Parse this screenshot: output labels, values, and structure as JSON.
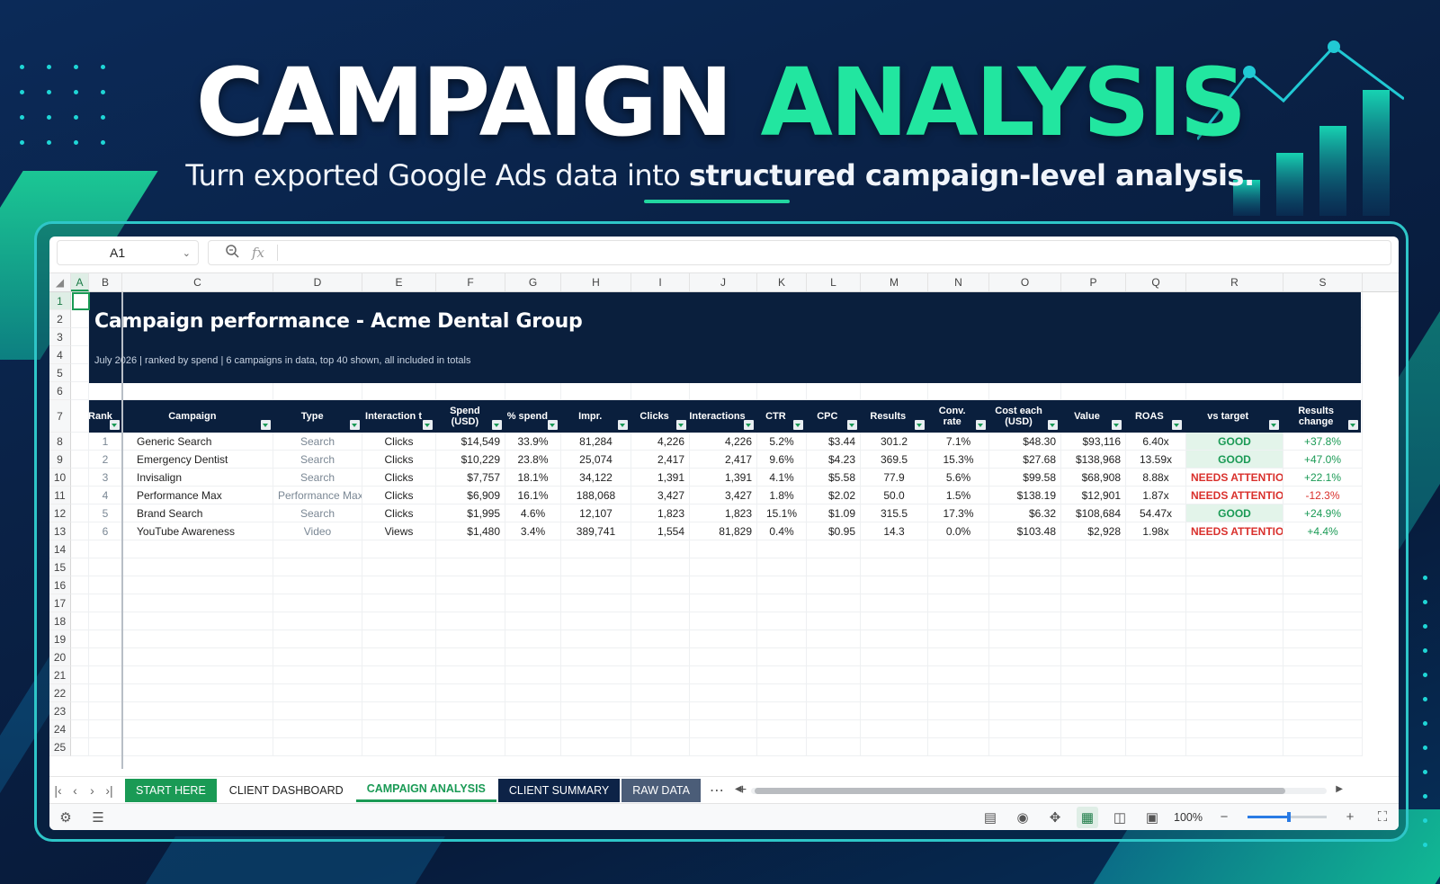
{
  "hero": {
    "title_word1": "CAMPAIGN",
    "title_word2": "ANALYSIS",
    "subtitle_plain": "Turn exported Google Ads data into ",
    "subtitle_bold": "structured campaign-level analysis."
  },
  "app": {
    "name_box": "A1",
    "formula": "",
    "columns": [
      "A",
      "B",
      "C",
      "D",
      "E",
      "F",
      "G",
      "H",
      "I",
      "J",
      "K",
      "L",
      "M",
      "N",
      "O",
      "P",
      "Q",
      "R",
      "S"
    ],
    "row_numbers": [
      "1",
      "2",
      "3",
      "4",
      "5",
      "6",
      "7",
      "8",
      "9",
      "10",
      "11",
      "12",
      "13",
      "14",
      "15",
      "16",
      "17",
      "18",
      "19",
      "20",
      "21",
      "22",
      "23",
      "24",
      "25"
    ],
    "sheet": {
      "title": "Campaign performance  -  Acme Dental Group",
      "subtitle": "July 2026  |  ranked by spend  |  6 campaigns in data, top 40 shown, all included in totals",
      "headers": [
        "Rank",
        "Campaign",
        "Type",
        "Interaction t",
        "Spend (USD)",
        "% spend",
        "Impr.",
        "Clicks",
        "Interactions",
        "CTR",
        "CPC",
        "Results",
        "Conv. rate",
        "Cost each (USD)",
        "Value",
        "ROAS",
        "vs target",
        "Results change"
      ],
      "rows": [
        [
          "1",
          "Generic Search",
          "Search",
          "Clicks",
          "$14,549",
          "33.9%",
          "81,284",
          "4,226",
          "4,226",
          "5.2%",
          "$3.44",
          "301.2",
          "7.1%",
          "$48.30",
          "$93,116",
          "6.40x",
          "GOOD",
          "+37.8%"
        ],
        [
          "2",
          "Emergency Dentist",
          "Search",
          "Clicks",
          "$10,229",
          "23.8%",
          "25,074",
          "2,417",
          "2,417",
          "9.6%",
          "$4.23",
          "369.5",
          "15.3%",
          "$27.68",
          "$138,968",
          "13.59x",
          "GOOD",
          "+47.0%"
        ],
        [
          "3",
          "Invisalign",
          "Search",
          "Clicks",
          "$7,757",
          "18.1%",
          "34,122",
          "1,391",
          "1,391",
          "4.1%",
          "$5.58",
          "77.9",
          "5.6%",
          "$99.58",
          "$68,908",
          "8.88x",
          "NEEDS ATTENTION",
          "+22.1%"
        ],
        [
          "4",
          "Performance Max",
          "Performance Max",
          "Clicks",
          "$6,909",
          "16.1%",
          "188,068",
          "3,427",
          "3,427",
          "1.8%",
          "$2.02",
          "50.0",
          "1.5%",
          "$138.19",
          "$12,901",
          "1.87x",
          "NEEDS ATTENTION",
          "-12.3%"
        ],
        [
          "5",
          "Brand Search",
          "Search",
          "Clicks",
          "$1,995",
          "4.6%",
          "12,107",
          "1,823",
          "1,823",
          "15.1%",
          "$1.09",
          "315.5",
          "17.3%",
          "$6.32",
          "$108,684",
          "54.47x",
          "GOOD",
          "+24.9%"
        ],
        [
          "6",
          "YouTube Awareness",
          "Video",
          "Views",
          "$1,480",
          "3.4%",
          "389,741",
          "1,554",
          "81,829",
          "0.4%",
          "$0.95",
          "14.3",
          "0.0%",
          "$103.48",
          "$2,928",
          "1.98x",
          "NEEDS ATTENTION",
          "+4.4%"
        ]
      ]
    },
    "tabs": [
      "START HERE",
      "CLIENT DASHBOARD",
      "CAMPAIGN ANALYSIS",
      "CLIENT SUMMARY",
      "RAW DATA"
    ],
    "active_tab": "CAMPAIGN ANALYSIS",
    "zoom": "100%",
    "colors": {
      "accent_green": "#1a9a55",
      "navy": "#0a1f3d",
      "bad_red": "#d9302c",
      "hero_green": "#22e6a0"
    }
  }
}
